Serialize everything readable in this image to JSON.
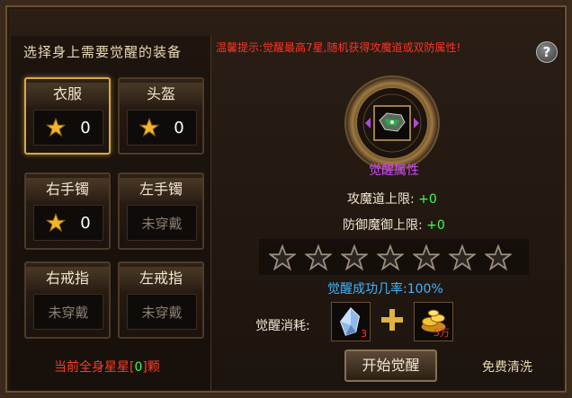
{
  "left": {
    "title": "选择身上需要觉醒的装备",
    "slots": [
      {
        "name": "衣服",
        "stars": "0",
        "worn": true,
        "selected": true
      },
      {
        "name": "头盔",
        "stars": "0",
        "worn": true,
        "selected": false
      },
      {
        "name": "右手镯",
        "stars": "0",
        "worn": true,
        "selected": false
      },
      {
        "name": "左手镯",
        "status": "未穿戴",
        "worn": false,
        "selected": false
      },
      {
        "name": "右戒指",
        "status": "未穿戴",
        "worn": false,
        "selected": false
      },
      {
        "name": "左戒指",
        "status": "未穿戴",
        "worn": false,
        "selected": false
      }
    ],
    "total_prefix": "当前全身星星[",
    "total_value": "0",
    "total_suffix": "]颗"
  },
  "right": {
    "hint": "温馨提示:觉醒最高7星,随机获得攻魔道或双防属性!",
    "help_glyph": "?",
    "attr_title": "觉醒属性",
    "attack_label": "攻魔道上限:",
    "attack_value": "+0",
    "defense_label": "防御魔御上限:",
    "defense_value": "+0",
    "stars_max": 7,
    "stars_filled": 0,
    "success_rate": "觉醒成功几率:100%",
    "cost_label": "觉醒消耗:",
    "cost_items": [
      {
        "icon": "crystal-icon",
        "count": "3"
      },
      {
        "icon": "gold-coins-icon",
        "count": "5万"
      }
    ],
    "start_button": "开始觉醒",
    "free_clear": "免费清洗"
  },
  "colors": {
    "accent_gold": "#d8a84a",
    "hint_red": "#ff3324",
    "value_green": "#3cff50",
    "attr_purple": "#d44bff",
    "rate_blue": "#3fb5ff"
  }
}
